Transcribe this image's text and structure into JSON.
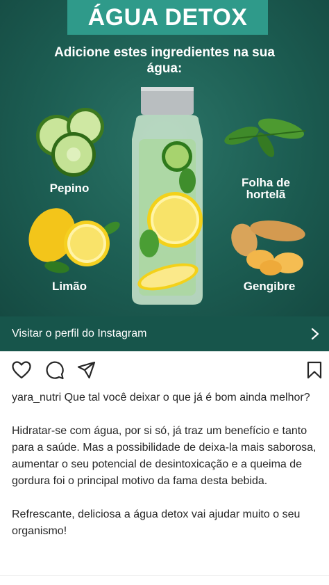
{
  "post_image": {
    "title": "ÁGUA DETOX",
    "subtitle": "Adicione estes ingredientes na sua água:",
    "ingredients": [
      {
        "label": "Pepino",
        "icon": "cucumber-icon"
      },
      {
        "label": "Folha de hortelã",
        "icon": "mint-leaf-icon"
      },
      {
        "label": "Limão",
        "icon": "lemon-icon"
      },
      {
        "label": "Gengibre",
        "icon": "ginger-icon"
      }
    ],
    "colors": {
      "background": "#1c5d52",
      "title_box": "#2f9a8a"
    }
  },
  "profile_bar": {
    "label": "Visitar o perfil do Instagram",
    "icon": "chevron-right-icon"
  },
  "actions": {
    "like_icon": "heart-icon",
    "comment_icon": "comment-icon",
    "share_icon": "send-icon",
    "save_icon": "bookmark-icon"
  },
  "caption": {
    "username": "yara_nutri",
    "first_line": "Que tal você deixar o que já é bom ainda melhor?",
    "paragraph2": "Hidratar-se com água, por si só, já traz um benefício e tanto para a saúde. Mas a possibilidade de deixa-la mais saborosa, aumentar o seu potencial de desintoxicação e a queima de gordura foi o principal motivo da fama desta bebida.",
    "paragraph3": "Refrescante, deliciosa a água detox vai ajudar muito o seu organismo!"
  }
}
